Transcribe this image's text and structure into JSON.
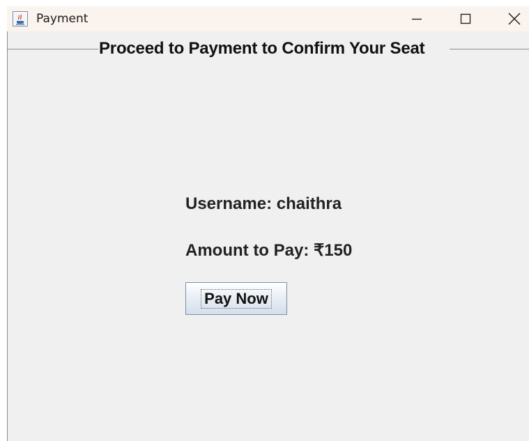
{
  "window": {
    "title": "Payment",
    "icon": "java-coffee-cup-icon",
    "controls": {
      "minimize": "minimize-icon",
      "maximize": "maximize-icon",
      "close": "close-icon"
    }
  },
  "panel": {
    "border_title": "Proceed to Payment to Confirm Your Seat"
  },
  "payment": {
    "username_text": "Username: chaithra",
    "amount_text": "Amount to Pay: ₹150",
    "pay_button_label": "Pay Now"
  },
  "colors": {
    "titlebar_bg": "#fbf3ee",
    "content_bg": "#f0f0f0",
    "button_border": "#7a8fa8"
  }
}
